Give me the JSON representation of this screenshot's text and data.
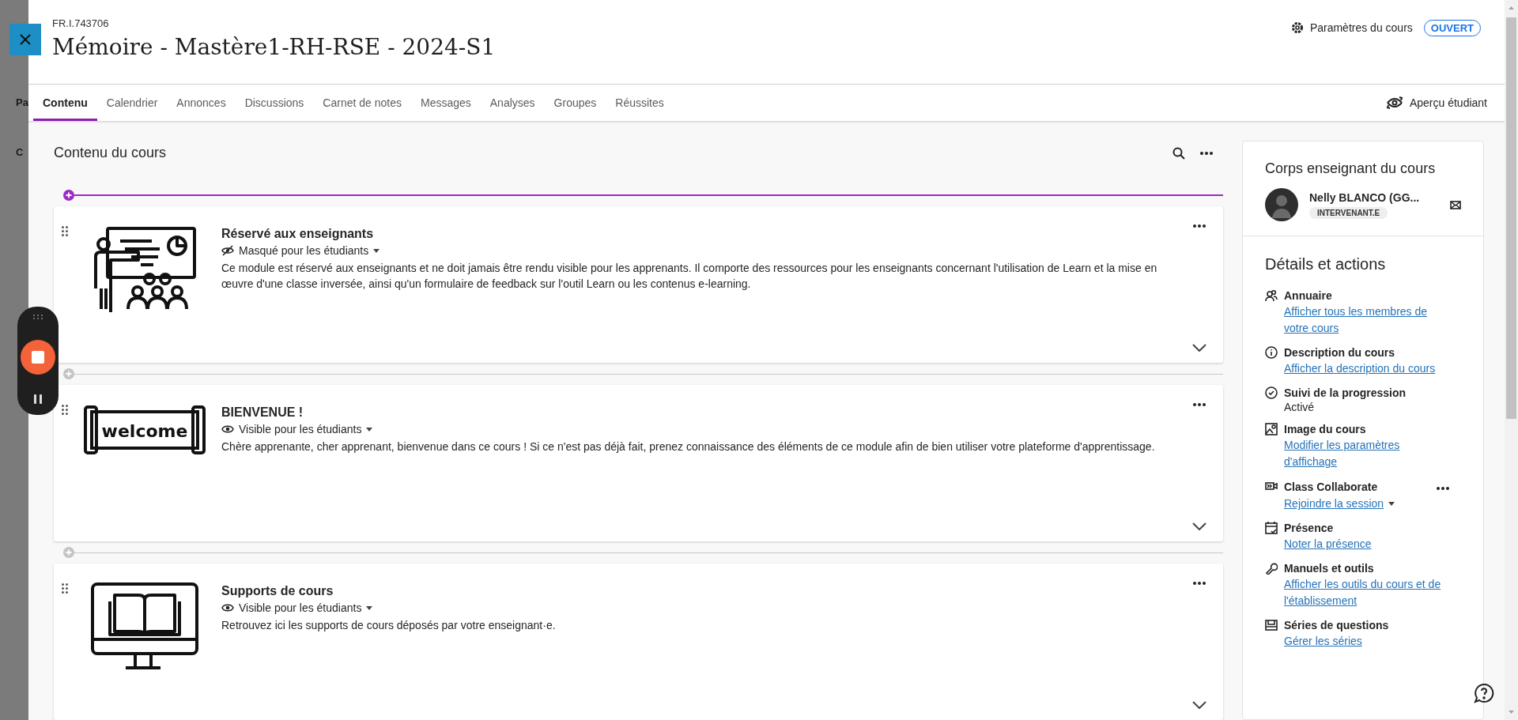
{
  "background_page": {
    "texts": [
      "Pa",
      "C"
    ]
  },
  "header": {
    "course_id": "FR.I.743706",
    "title": "Mémoire - Mastère1-RH-RSE - 2024-S1",
    "settings_label": "Paramètres du cours",
    "status": "OUVERT"
  },
  "tabs": [
    {
      "label": "Contenu",
      "selected": true
    },
    {
      "label": "Calendrier",
      "selected": false
    },
    {
      "label": "Annonces",
      "selected": false
    },
    {
      "label": "Discussions",
      "selected": false
    },
    {
      "label": "Carnet de notes",
      "selected": false
    },
    {
      "label": "Messages",
      "selected": false
    },
    {
      "label": "Analyses",
      "selected": false
    },
    {
      "label": "Groupes",
      "selected": false
    },
    {
      "label": "Réussites",
      "selected": false
    }
  ],
  "student_preview": "Aperçu étudiant",
  "content": {
    "heading": "Contenu du cours",
    "modules": [
      {
        "kind": "presenter",
        "title": "Réservé aux enseignants",
        "visible": false,
        "visibility": "Masqué pour les étudiants",
        "description": "Ce module est réservé aux enseignants et ne doit jamais être rendu visible pour les apprenants. Il comporte des ressources pour les enseignants concernant l'utilisation de Learn et la mise en œuvre d'une classe inversée, ainsi qu'un formulaire de feedback sur l'outil Learn ou les contenus e-learning."
      },
      {
        "kind": "welcome",
        "image_text": "welcome",
        "title": "BIENVENUE !",
        "visible": true,
        "visibility": "Visible pour les étudiants",
        "description": "Chère apprenante, cher apprenant, bienvenue dans ce cours ! Si ce n'est pas déjà fait, prenez connaissance des éléments de ce module afin de bien utiliser votre plateforme d'apprentissage."
      },
      {
        "kind": "monitor-book",
        "title": "Supports de cours",
        "visible": true,
        "visibility": "Visible pour les étudiants",
        "description": "Retrouvez ici les supports de cours déposés par votre enseignant·e."
      }
    ]
  },
  "sidebar": {
    "instructors_heading": "Corps enseignant du cours",
    "instructor": {
      "name": "Nelly BLANCO (GG...",
      "role": "INTERVENANT.E"
    },
    "details_heading": "Détails et actions",
    "items": [
      {
        "kind": "link",
        "label": "Annuaire",
        "value": "Afficher tous les membres de votre cours"
      },
      {
        "kind": "link",
        "label": "Description du cours",
        "value": "Afficher la description du cours"
      },
      {
        "kind": "status",
        "label": "Suivi de la progression",
        "value": "Activé"
      },
      {
        "kind": "link",
        "label": "Image du cours",
        "value": "Modifier les paramètres d'affichage"
      },
      {
        "kind": "session",
        "label": "Class Collaborate",
        "value": "Rejoindre la session"
      },
      {
        "kind": "link",
        "label": "Présence",
        "value": "Noter la présence"
      },
      {
        "kind": "link",
        "label": "Manuels et outils",
        "value": "Afficher les outils du cours et de l'établissement"
      },
      {
        "kind": "link",
        "label": "Séries de questions",
        "value": "Gérer les séries"
      }
    ]
  }
}
